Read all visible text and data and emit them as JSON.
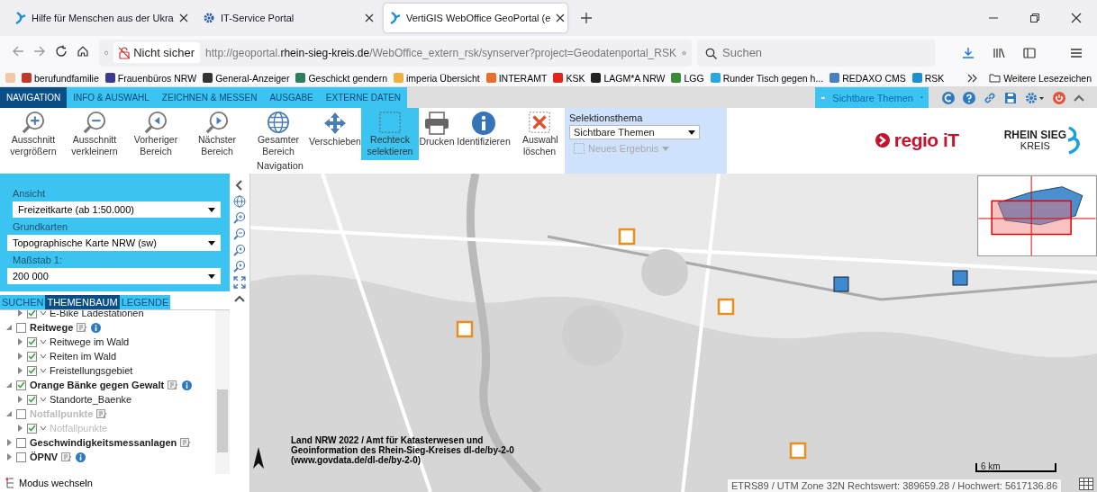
{
  "browser": {
    "tabs": [
      {
        "title": "Hilfe für Menschen aus der Ukra",
        "selected": false
      },
      {
        "title": "IT-Service Portal",
        "selected": false
      },
      {
        "title": "VertiGIS WebOffice GeoPortal (e",
        "selected": true
      }
    ],
    "security": "Nicht sicher",
    "url": {
      "prefix": "http://geoportal.",
      "domain": "rhein-sieg-kreis.de",
      "path": "/WebOffice_extern_rsk/synserver?project=Geodatenportal_RSK"
    },
    "search": {
      "placeholder": "Suchen"
    },
    "bookmarks": [
      {
        "label": "berufundfamilie",
        "color": "#c0392b"
      },
      {
        "label": "Frauenbüros NRW",
        "color": "#3b3b8f"
      },
      {
        "label": "General-Anzeiger",
        "color": "#333333"
      },
      {
        "label": "Geschickt gendern",
        "color": "#2e7d5b"
      },
      {
        "label": "imperia Übersicht",
        "color": "#f0b040"
      },
      {
        "label": "INTERAMT",
        "color": "#e8702a"
      },
      {
        "label": "KSK",
        "color": "#e2231a"
      },
      {
        "label": "LAGM*A NRW",
        "color": "#222222"
      },
      {
        "label": "LGG",
        "color": "#3a8a3a"
      },
      {
        "label": "Runder Tisch gegen h...",
        "color": "#29a8e0"
      },
      {
        "label": "REDAXO CMS",
        "color": "#4a7fc1"
      },
      {
        "label": "RSK",
        "color": "#1e90d0"
      }
    ],
    "more_bookmarks": "Weitere Lesezeichen"
  },
  "app": {
    "tabs": [
      {
        "label": "NAVIGATION",
        "selected": true
      },
      {
        "label": "INFO & AUSWAHL",
        "selected": false
      },
      {
        "label": "ZEICHNEN & MESSEN",
        "selected": false
      },
      {
        "label": "AUSGABE",
        "selected": false
      },
      {
        "label": "EXTERNE DATEN",
        "selected": false
      }
    ],
    "theme_button": "Sichtbare Themen",
    "ribbon": [
      {
        "kind": "zoomin",
        "label": "Ausschnitt vergrößern",
        "selected": false
      },
      {
        "kind": "zoomout",
        "label": "Ausschnitt verkleinern",
        "selected": false
      },
      {
        "kind": "prev",
        "label": "Vorheriger Bereich",
        "selected": false
      },
      {
        "kind": "next",
        "label": "Nächster Bereich",
        "selected": false
      },
      {
        "kind": "globe",
        "label": "Gesamter Bereich",
        "selected": false
      },
      {
        "kind": "move",
        "label": "Verschieben",
        "selected": false
      },
      {
        "kind": "rect",
        "label": "Rechteck selektieren",
        "selected": true
      },
      {
        "kind": "print",
        "label": "Drucken",
        "selected": false
      },
      {
        "kind": "info",
        "label": "Identifizieren",
        "selected": false
      },
      {
        "kind": "clear",
        "label": "Auswahl löschen",
        "selected": false
      }
    ],
    "ribbon_group": "Navigation",
    "selection": {
      "label": "Selektionsthema",
      "value": "Sichtbare Themen",
      "new_result": "Neues Ergebnis"
    },
    "logos": {
      "regio": "regio iT",
      "rsk_top": "RHEIN SIEG",
      "rsk_bottom": "KREIS"
    },
    "panel": {
      "fields": [
        {
          "label": "Ansicht",
          "value": "Freizeitkarte (ab 1:50.000)"
        },
        {
          "label": "Grundkarten",
          "value": "Topographische Karte NRW (sw)"
        },
        {
          "label": "Maßstab 1:",
          "value": "200 000"
        }
      ],
      "tabs": [
        {
          "label": "SUCHEN",
          "selected": false
        },
        {
          "label": "THEMENBAUM",
          "selected": true
        },
        {
          "label": "LEGENDE",
          "selected": false
        }
      ],
      "tree": [
        {
          "kind": "layer",
          "label": "E-Bike Ladestationen",
          "checked": true,
          "disabled": false
        },
        {
          "kind": "group",
          "label": "Reitwege",
          "checked": false,
          "expanded": true,
          "info": true,
          "disabled": false,
          "children": [
            {
              "kind": "layer",
              "label": "Reitwege im Wald",
              "checked": true,
              "disabled": false
            },
            {
              "kind": "layer",
              "label": "Reiten im Wald",
              "checked": true,
              "disabled": false
            },
            {
              "kind": "layer",
              "label": "Freistellungsgebiet",
              "checked": true,
              "disabled": false
            }
          ]
        },
        {
          "kind": "group",
          "label": "Orange Bänke gegen Gewalt",
          "checked": true,
          "expanded": true,
          "info": true,
          "disabled": false,
          "children": [
            {
              "kind": "layer",
              "label": "Standorte_Baenke",
              "checked": true,
              "disabled": false
            }
          ]
        },
        {
          "kind": "group",
          "label": "Notfallpunkte",
          "checked": false,
          "expanded": true,
          "info": false,
          "disabled": true,
          "children": [
            {
              "kind": "layer",
              "label": "Notfallpunkte",
              "checked": true,
              "disabled": true
            }
          ]
        },
        {
          "kind": "group",
          "label": "Geschwindigkeitsmessanlagen",
          "checked": false,
          "expanded": false,
          "info": false,
          "disabled": false
        },
        {
          "kind": "group",
          "label": "ÖPNV",
          "checked": false,
          "expanded": false,
          "info": true,
          "disabled": false
        }
      ],
      "mode": "Modus wechseln"
    },
    "map": {
      "kind": "picture",
      "attribution": "Land NRW 2022 / Amt für Katasterwesen und Geoinformation des Rhein-Sieg-Kreises dl-de/by-2-0 (www.govdata.de/dl-de/by-2-0)",
      "scale": "6 km",
      "coordinates": "ETRS89 / UTM Zone 32N Rechtswert: 389659.28 / Hochwert: 5617136.86"
    }
  }
}
